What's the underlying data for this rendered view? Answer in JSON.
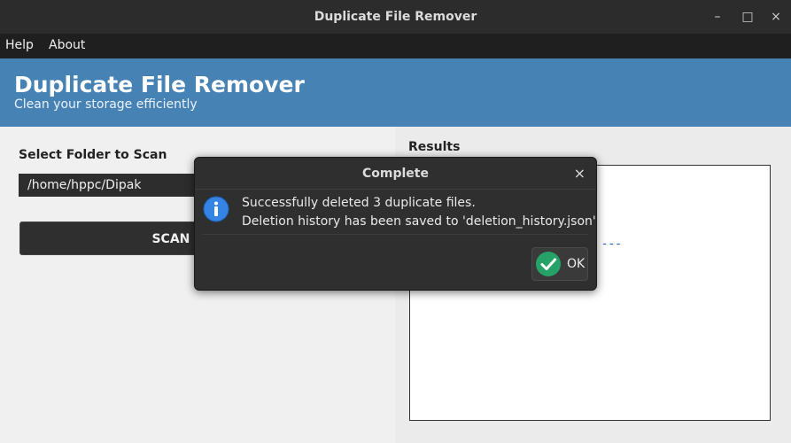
{
  "window": {
    "title": "Duplicate File Remover",
    "controls": {
      "minimize": "–",
      "maximize": "□",
      "close": "×"
    }
  },
  "menu": [
    "Help",
    "About"
  ],
  "banner": {
    "title": "Duplicate File Remover",
    "subtitle": "Clean your storage efficiently",
    "color": "#4682b4"
  },
  "left_panel": {
    "folder_label": "Select Folder to Scan",
    "folder_value": "/home/hppc/Dipak",
    "scan_button": "SCAN & REMO"
  },
  "right_panel": {
    "results_label": "Results",
    "lines": [
      "---",
      "d ---"
    ]
  },
  "dialog": {
    "title": "Complete",
    "close": "×",
    "message_line1": "Successfully deleted 3 duplicate files.",
    "message_line2": "Deletion history has been saved to 'deletion_history.json'",
    "ok_label": "OK",
    "info_icon": "info-icon",
    "ok_icon": "check-icon"
  }
}
